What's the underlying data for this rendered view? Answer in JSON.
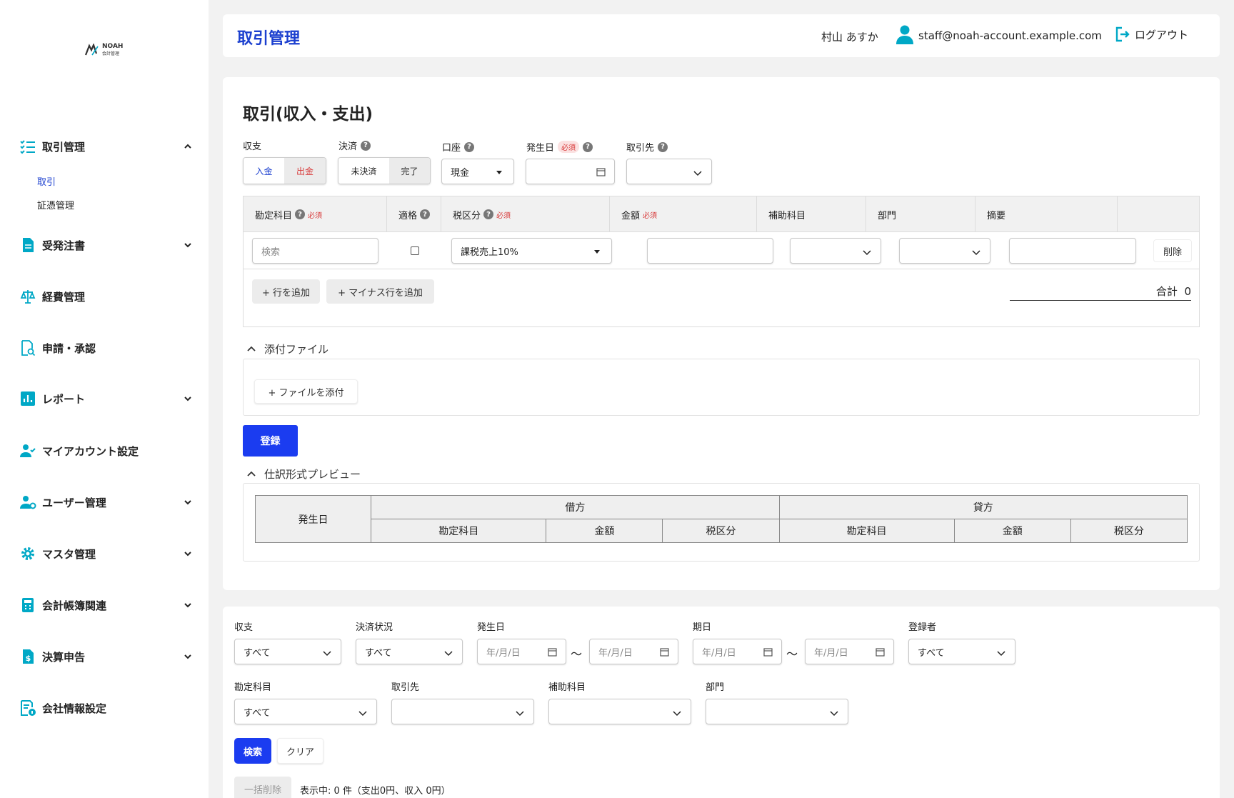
{
  "app": {
    "logo_text": "NOAH",
    "logo_sub": "会計管理"
  },
  "sidebar": {
    "items": [
      {
        "label": "取引管理",
        "icon": "checklist-icon"
      },
      {
        "label": "受発注書",
        "icon": "document-icon"
      },
      {
        "label": "経費管理",
        "icon": "scale-icon"
      },
      {
        "label": "申請・承認",
        "icon": "document-search-icon"
      },
      {
        "label": "レポート",
        "icon": "bar-chart-icon"
      },
      {
        "label": "マイアカウント設定",
        "icon": "user-check-icon"
      },
      {
        "label": "ユーザー管理",
        "icon": "user-gear-icon"
      },
      {
        "label": "マスタ管理",
        "icon": "gear-icon"
      },
      {
        "label": "会計帳簿関連",
        "icon": "calculator-icon"
      },
      {
        "label": "決算申告",
        "icon": "dollar-document-icon"
      },
      {
        "label": "会社情報設定",
        "icon": "company-info-icon"
      }
    ],
    "subitems": [
      {
        "label": "取引"
      },
      {
        "label": "証憑管理"
      }
    ]
  },
  "header": {
    "title": "取引管理",
    "user_name": "村山 あすか",
    "user_email": "staff@noah-account.example.com",
    "logout": "ログアウト"
  },
  "form": {
    "title": "取引(収入・支出)",
    "labels": {
      "shushi": "収支",
      "kessai": "決済",
      "koza": "口座",
      "hasseibi": "発生日",
      "torihikisaki": "取引先",
      "required": "必須"
    },
    "shushi_options": [
      "入金",
      "出金"
    ],
    "kessai_options": [
      "未決済",
      "完了"
    ],
    "koza_value": "現金",
    "table": {
      "headers": [
        "勘定科目",
        "適格",
        "税区分",
        "金額",
        "補助科目",
        "部門",
        "摘要"
      ],
      "search_placeholder": "検索",
      "tax_value": "課税売上10%",
      "delete": "削除"
    },
    "add_row": "+ 行を追加",
    "add_minus_row": "+ マイナス行を追加",
    "total_label": "合計",
    "total_value": "0",
    "attachments_title": "添付ファイル",
    "attach_button": "+ ファイルを添付",
    "submit": "登録",
    "preview_title": "仕訳形式プレビュー",
    "preview": {
      "date": "発生日",
      "debit": "借方",
      "credit": "貸方",
      "cols": [
        "勘定科目",
        "金額",
        "税区分"
      ]
    }
  },
  "filters": {
    "labels": [
      "収支",
      "決済状況",
      "発生日",
      "期日",
      "登録者",
      "勘定科目",
      "取引先",
      "補助科目",
      "部門"
    ],
    "all": "すべて",
    "date_placeholder": "年/月/日",
    "tilde": "〜",
    "search": "検索",
    "clear": "クリア",
    "bulk_delete": "一括削除",
    "status": "表示中: 0 件（支出0円、収入 0円）"
  },
  "colors": {
    "primary": "#1b3cf0",
    "accent": "#00a8c6",
    "required": "#d83a3a"
  }
}
